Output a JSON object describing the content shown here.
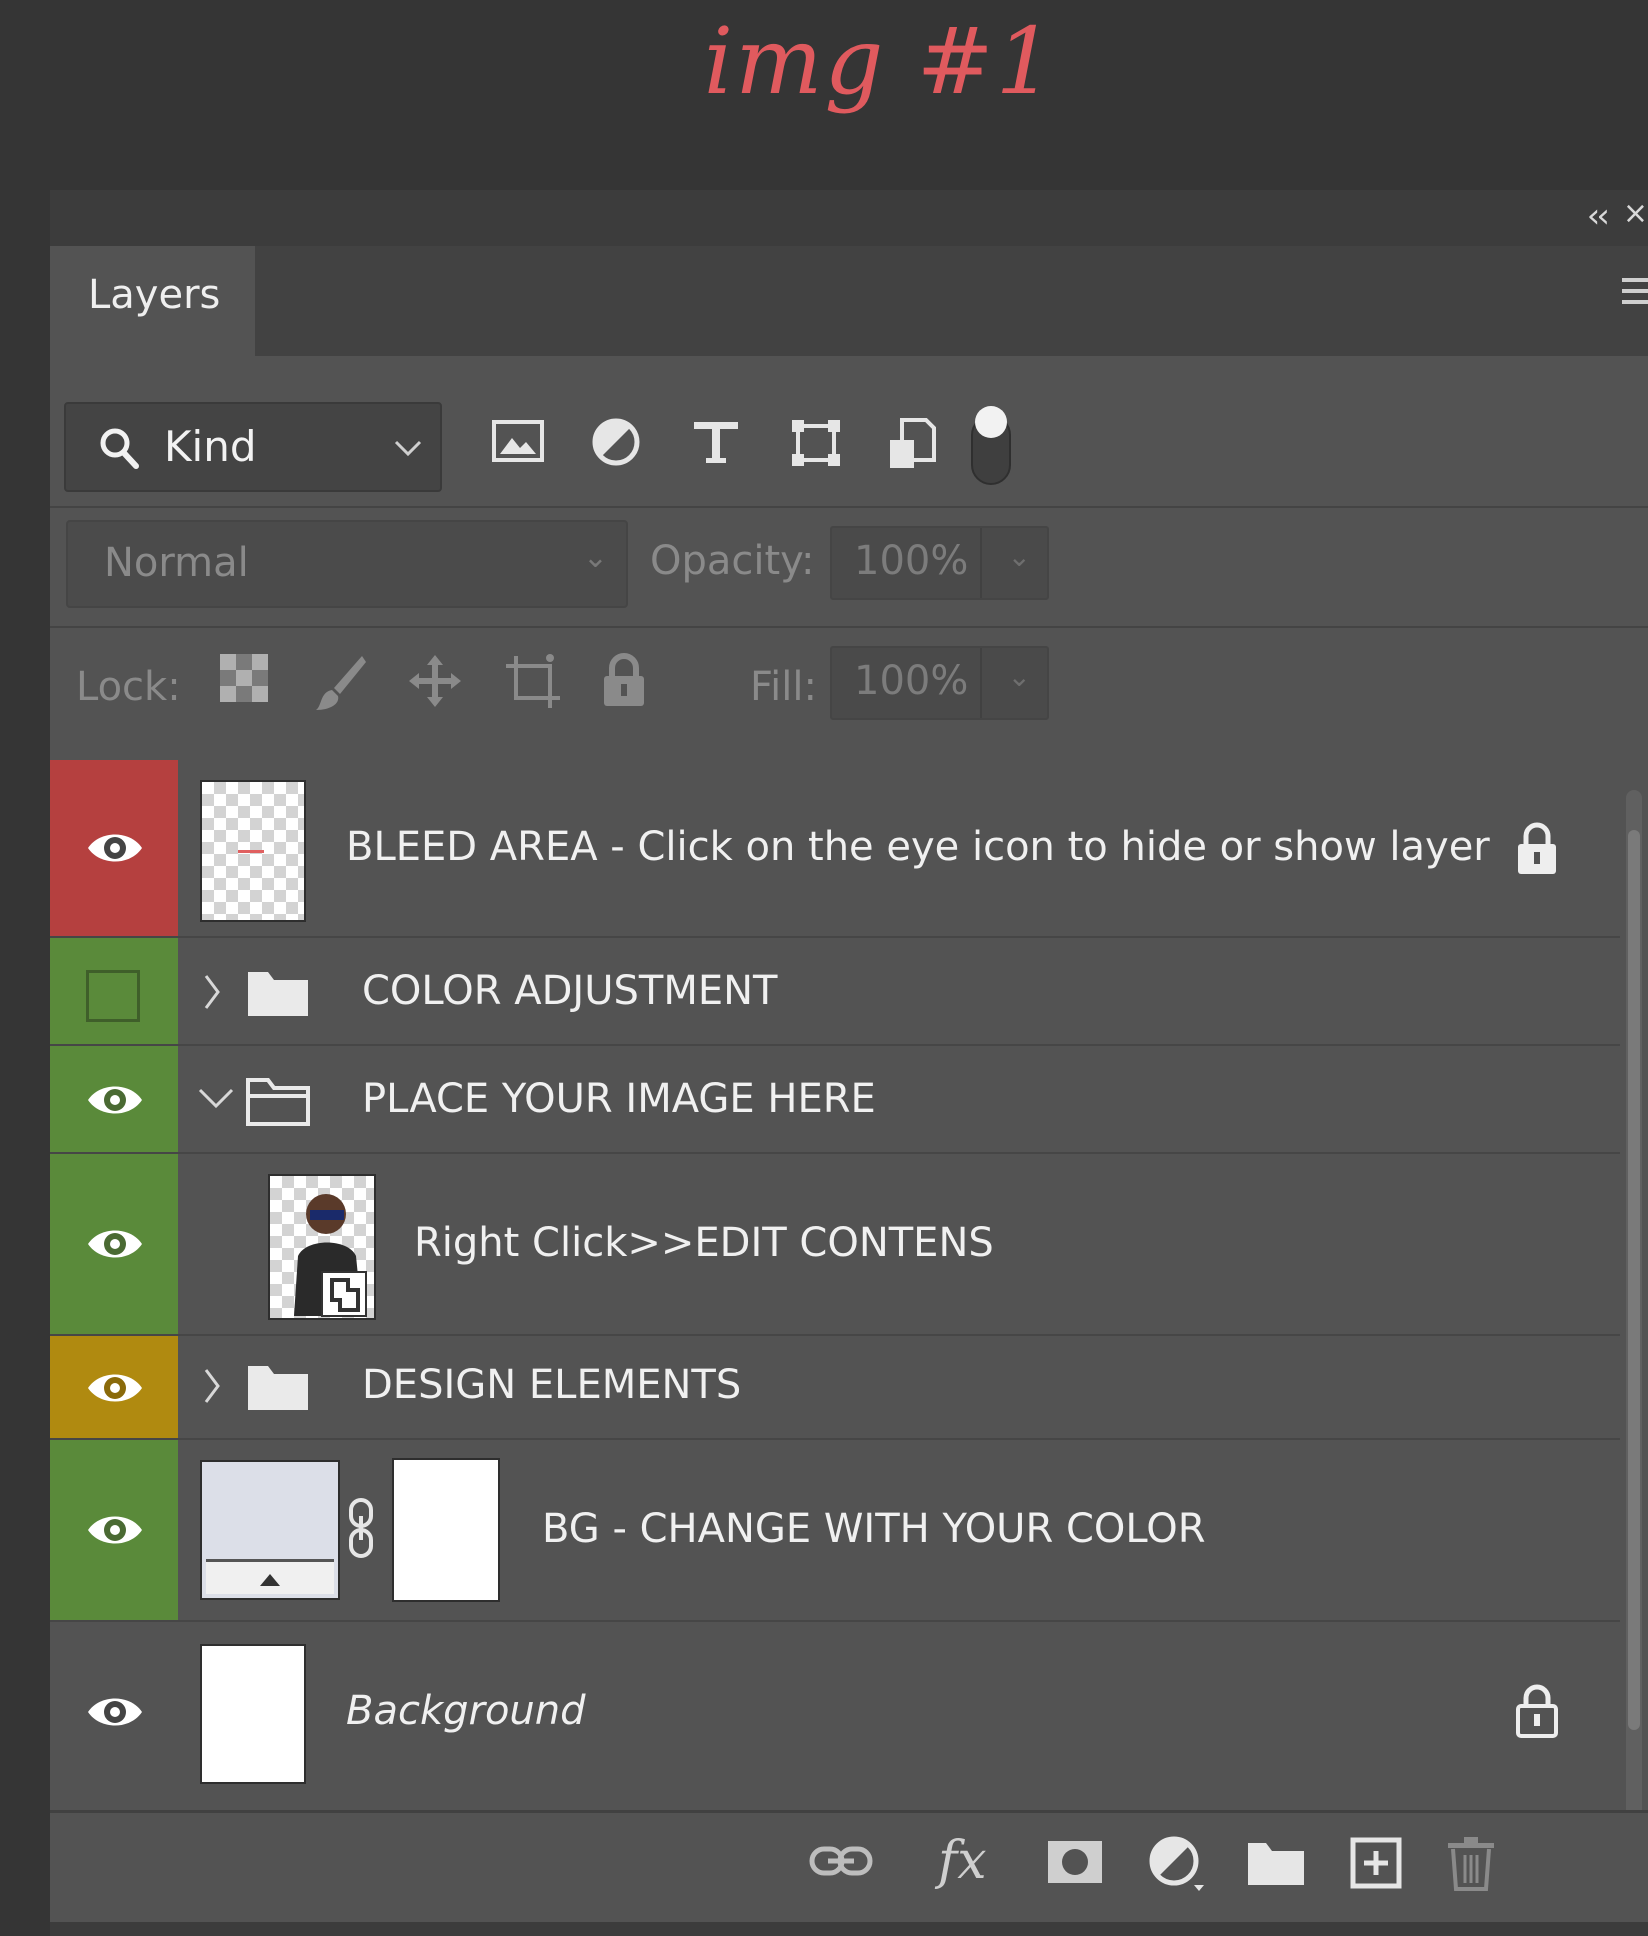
{
  "annotation": {
    "text": "img #1",
    "color": "#e05a5e"
  },
  "panel": {
    "tab_label": "Layers",
    "collapse_glyph": "‹‹",
    "close_glyph": "×"
  },
  "filter": {
    "kind_label": "Kind",
    "icons": [
      "pixel-layer-filter-icon",
      "adjustment-layer-filter-icon",
      "type-layer-filter-icon",
      "shape-layer-filter-icon",
      "smart-object-filter-icon",
      "filter-toggle-switch"
    ]
  },
  "blend": {
    "mode": "Normal",
    "opacity_label": "Opacity:",
    "opacity_value": "100%"
  },
  "lock": {
    "label": "Lock:",
    "fill_label": "Fill:",
    "fill_value": "100%"
  },
  "layers": [
    {
      "name": "BLEED AREA - Click on the eye icon to hide or show layer",
      "color_tag": "#b5403f",
      "visible": true,
      "locked": true,
      "type": "pixel"
    },
    {
      "name": "COLOR ADJUSTMENT",
      "color_tag": "#5a8a3a",
      "visible": false,
      "type": "group",
      "expanded": false
    },
    {
      "name": "PLACE YOUR IMAGE HERE",
      "color_tag": "#5a8a3a",
      "visible": true,
      "type": "group",
      "expanded": true
    },
    {
      "name": "Right Click>>EDIT CONTENS",
      "color_tag": "#5a8a3a",
      "visible": true,
      "type": "smart-object"
    },
    {
      "name": "DESIGN ELEMENTS",
      "color_tag": "#b08a10",
      "visible": true,
      "type": "group",
      "expanded": false
    },
    {
      "name": "BG - CHANGE WITH YOUR COLOR",
      "color_tag": "#5a8a3a",
      "visible": true,
      "type": "fill-with-mask"
    },
    {
      "name": "Background",
      "color_tag": "",
      "visible": true,
      "locked": true,
      "type": "background"
    }
  ],
  "bottom_icons": [
    "link-layers-icon",
    "fx-icon",
    "add-mask-icon",
    "new-adjustment-icon",
    "new-group-icon",
    "new-layer-icon",
    "delete-layer-icon"
  ],
  "fx_label": "fx"
}
